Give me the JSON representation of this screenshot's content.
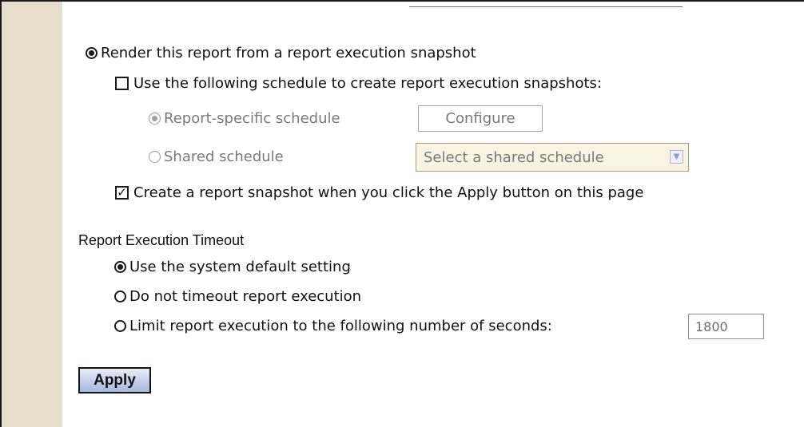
{
  "render_snapshot": {
    "label": "Render this report from a report execution snapshot",
    "selected": true
  },
  "use_schedule": {
    "label": "Use the following schedule to create report execution snapshots:",
    "checked": false
  },
  "report_specific": {
    "label": "Report-specific schedule",
    "selected": true,
    "disabled": true,
    "configure_label": "Configure"
  },
  "shared_schedule": {
    "label": "Shared schedule",
    "selected": false,
    "disabled": true,
    "select_value": "Select a shared schedule"
  },
  "create_snapshot": {
    "label": "Create a report snapshot when you click the Apply button on this page",
    "checked": true
  },
  "timeout": {
    "heading": "Report Execution Timeout",
    "options": [
      {
        "label": "Use the system default setting",
        "selected": true
      },
      {
        "label": "Do not timeout report execution",
        "selected": false
      },
      {
        "label": "Limit report execution to the following number of seconds:",
        "selected": false
      }
    ],
    "seconds_value": "1800"
  },
  "apply_label": "Apply",
  "colors": {
    "sidebar": "#e6decb",
    "apply_button": "#a6b8dd",
    "disabled_text": "#7a7a7a"
  }
}
